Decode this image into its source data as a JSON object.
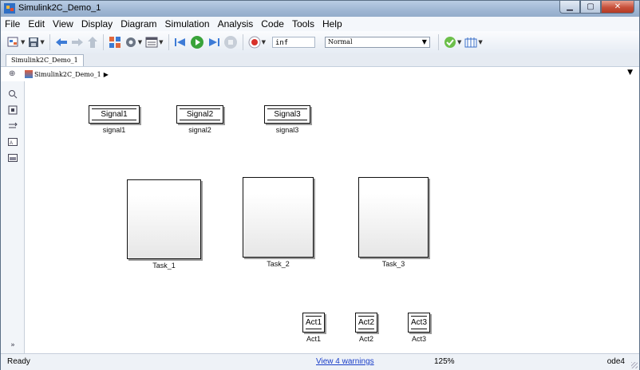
{
  "window": {
    "title": "Simulink2C_Demo_1"
  },
  "menu": [
    "File",
    "Edit",
    "View",
    "Display",
    "Diagram",
    "Simulation",
    "Analysis",
    "Code",
    "Tools",
    "Help"
  ],
  "toolbar": {
    "stop_time": "inf",
    "sim_mode": "Normal"
  },
  "tab": {
    "label": "Simulink2C_Demo_1"
  },
  "breadcrumb": {
    "model": "Simulink2C_Demo_1"
  },
  "blocks": {
    "from": [
      {
        "text": "Signal1",
        "label": "signal1"
      },
      {
        "text": "Signal2",
        "label": "signal2"
      },
      {
        "text": "Signal3",
        "label": "signal3"
      }
    ],
    "tasks": [
      {
        "label": "Task_1"
      },
      {
        "label": "Task_2"
      },
      {
        "label": "Task_3"
      }
    ],
    "acts": [
      {
        "text": "Act1",
        "label": "Act1"
      },
      {
        "text": "Act2",
        "label": "Act2"
      },
      {
        "text": "Act3",
        "label": "Act3"
      }
    ]
  },
  "palette": {
    "expand": "»"
  },
  "status": {
    "ready": "Ready",
    "warnings": "View 4 warnings",
    "zoom": "125%",
    "solver": "ode4"
  },
  "icons": [
    "app-icon",
    "minimize-icon",
    "maximize-icon",
    "close-icon",
    "new-model-icon",
    "save-icon",
    "back-icon",
    "forward-icon",
    "up-icon",
    "library-icon",
    "settings-icon",
    "explorer-icon",
    "step-back-icon",
    "run-icon",
    "step-forward-icon",
    "stop-icon",
    "record-icon",
    "check-icon",
    "build-icon"
  ]
}
